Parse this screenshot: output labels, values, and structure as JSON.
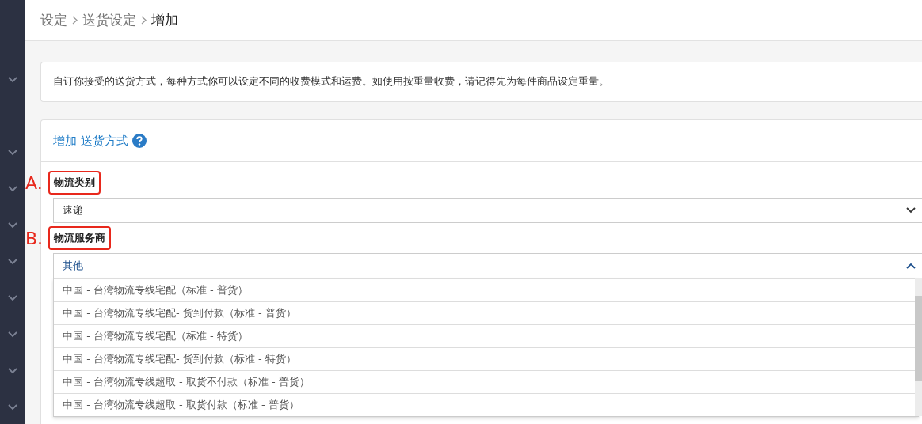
{
  "breadcrumb": [
    {
      "label": "设定",
      "current": false
    },
    {
      "label": "送货设定",
      "current": false
    },
    {
      "label": "增加",
      "current": true
    }
  ],
  "notice": "自订你接受的送货方式，每种方式你可以设定不同的收费模式和运费。如使用按重量收费，请记得先为每件商品设定重量。",
  "form": {
    "title": "增加 送货方式",
    "fields": [
      {
        "label": "物流类别",
        "annotation": "A.",
        "value": "速递",
        "expanded": false
      },
      {
        "label": "物流服务商",
        "annotation": "B.",
        "value": "其他",
        "expanded": true,
        "options": [
          "中国 - 台湾物流专线宅配（标准 - 普货）",
          "中国 - 台湾物流专线宅配- 货到付款（标准 - 普货）",
          "中国 - 台湾物流专线宅配（标准 - 特货）",
          "中国 - 台湾物流专线宅配- 货到付款（标准 - 特货）",
          "中国 - 台湾物流专线超取 - 取货不付款（标准 - 普货）",
          "中国 - 台湾物流专线超取 - 取货付款（标准 - 普货）"
        ]
      }
    ]
  }
}
